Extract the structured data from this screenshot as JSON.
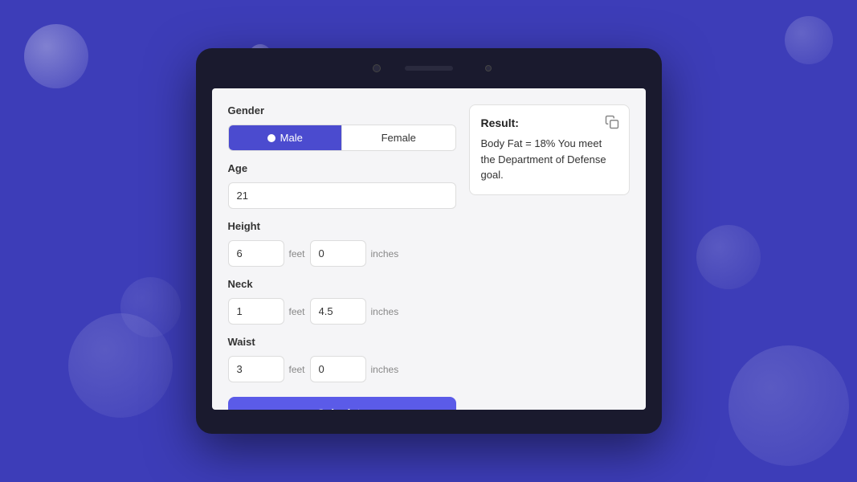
{
  "background": {
    "color": "#3d3db8"
  },
  "form": {
    "gender_label": "Gender",
    "gender_options": [
      {
        "id": "male",
        "label": "Male",
        "selected": true
      },
      {
        "id": "female",
        "label": "Female",
        "selected": false
      }
    ],
    "age_label": "Age",
    "age_value": "21",
    "age_placeholder": "",
    "height_label": "Height",
    "height_feet_value": "6",
    "height_inches_value": "0",
    "neck_label": "Neck",
    "neck_feet_value": "1",
    "neck_inches_value": "4.5",
    "waist_label": "Waist",
    "waist_feet_value": "3",
    "waist_inches_value": "0",
    "units": {
      "feet": "feet",
      "inches": "inches"
    },
    "calculate_button_label": "Calculate"
  },
  "result": {
    "title": "Result:",
    "text": "Body Fat = 18% You meet the Department of Defense goal."
  }
}
